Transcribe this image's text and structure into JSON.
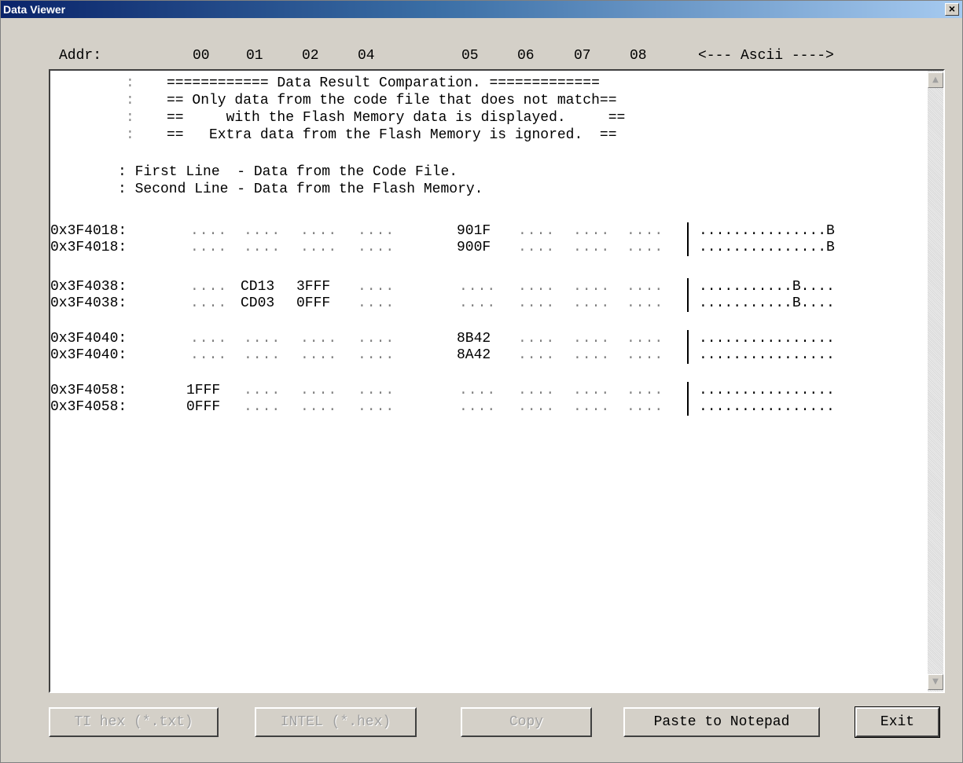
{
  "window": {
    "title": "Data Viewer",
    "close_glyph": "×"
  },
  "header": {
    "addr": "Addr:",
    "cols": [
      "00",
      "01",
      "02",
      "04",
      "05",
      "06",
      "07",
      "08"
    ],
    "ascii": "<--- Ascii ---->"
  },
  "notes": {
    "banner_colons": [
      ":",
      ":",
      ":",
      ":"
    ],
    "banner_lines": [
      "============ Data Result Comparation. =============",
      "== Only data from the code file that does not match==",
      "==     with the Flash Memory data is displayed.     ==",
      "==   Extra data from the Flash Memory is ignored.  =="
    ],
    "legend_lines": [
      ": First Line  - Data from the Code File.",
      ": Second Line - Data from the Flash Memory."
    ]
  },
  "rows": [
    {
      "addr": "0x3F4018:",
      "cells": [
        "....",
        "....",
        "....",
        "....",
        "901F",
        "....",
        "....",
        "...."
      ],
      "ascii": "...............B"
    },
    {
      "addr": "0x3F4018:",
      "cells": [
        "....",
        "....",
        "....",
        "....",
        "900F",
        "....",
        "....",
        "...."
      ],
      "ascii": "...............B"
    },
    {
      "addr": "0x3F4038:",
      "cells": [
        "....",
        "CD13",
        "3FFF",
        "....",
        "....",
        "....",
        "....",
        "...."
      ],
      "ascii": "...........B...."
    },
    {
      "addr": "0x3F4038:",
      "cells": [
        "....",
        "CD03",
        "0FFF",
        "....",
        "....",
        "....",
        "....",
        "...."
      ],
      "ascii": "...........B...."
    },
    {
      "addr": "0x3F4040:",
      "cells": [
        "....",
        "....",
        "....",
        "....",
        "8B42",
        "....",
        "....",
        "...."
      ],
      "ascii": "................"
    },
    {
      "addr": "0x3F4040:",
      "cells": [
        "....",
        "....",
        "....",
        "....",
        "8A42",
        "....",
        "....",
        "...."
      ],
      "ascii": "................"
    },
    {
      "addr": "0x3F4058:",
      "cells": [
        "1FFF",
        "....",
        "....",
        "....",
        "....",
        "....",
        "....",
        "...."
      ],
      "ascii": "................"
    },
    {
      "addr": "0x3F4058:",
      "cells": [
        "0FFF",
        "....",
        "....",
        "....",
        "....",
        "....",
        "....",
        "...."
      ],
      "ascii": "................"
    }
  ],
  "scrollbar": {
    "up_glyph": "▲",
    "down_glyph": "▼"
  },
  "buttons": {
    "ti_hex": "TI hex (*.txt)",
    "intel": "INTEL (*.hex)",
    "copy": "Copy",
    "paste": "Paste to Notepad",
    "exit": "Exit"
  },
  "colors": {
    "title_start": "#0a246a",
    "title_end": "#a6caf0",
    "face": "#d4d0c8"
  }
}
